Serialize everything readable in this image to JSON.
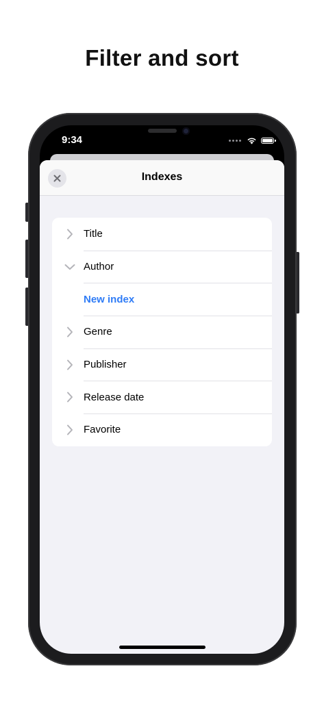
{
  "headline": "Filter and sort",
  "status_bar": {
    "time": "9:34",
    "icons": [
      "signal-dots-icon",
      "wifi-icon",
      "battery-icon"
    ]
  },
  "sheet": {
    "title": "Indexes",
    "close_icon": "close-icon"
  },
  "list": {
    "items": [
      {
        "label": "Title",
        "icon": "chevron-right-icon",
        "expanded": false
      },
      {
        "label": "Author",
        "icon": "chevron-down-icon",
        "expanded": true
      },
      {
        "label": "New index",
        "icon": "",
        "is_action": true
      },
      {
        "label": "Genre",
        "icon": "chevron-right-icon",
        "expanded": false
      },
      {
        "label": "Publisher",
        "icon": "chevron-right-icon",
        "expanded": false
      },
      {
        "label": "Release date",
        "icon": "chevron-right-icon",
        "expanded": false
      },
      {
        "label": "Favorite",
        "icon": "chevron-right-icon",
        "expanded": false
      }
    ]
  },
  "colors": {
    "accent": "#2f7cf6",
    "sheet_background": "#f2f2f7",
    "phone_frame": "#1c1c1e"
  }
}
